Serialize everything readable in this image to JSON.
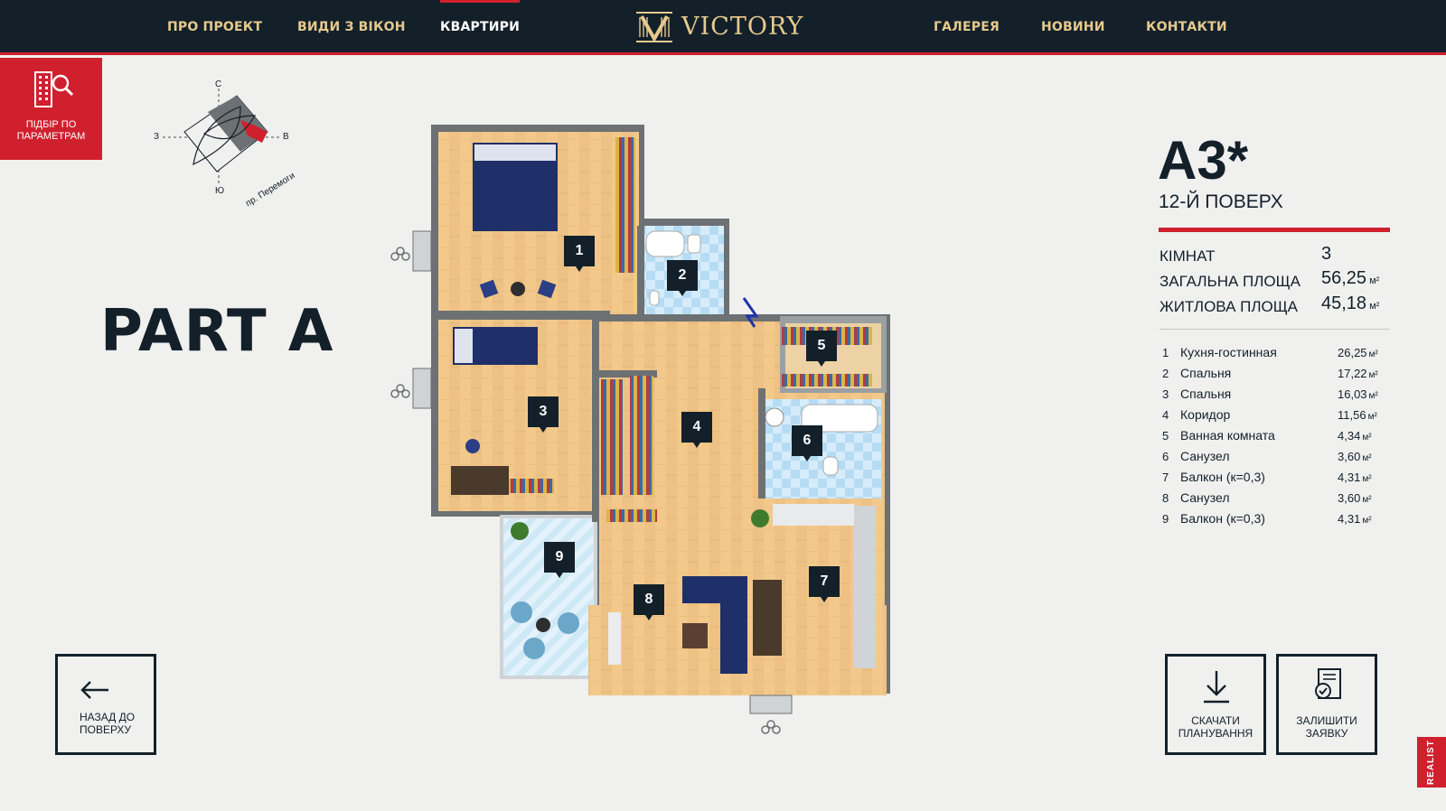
{
  "nav": {
    "left": [
      "ПРО ПРОЕКТ",
      "ВИДИ З ВІКОН",
      "КВАРТИРИ"
    ],
    "right": [
      "ГАЛЕРЕЯ",
      "НОВИНИ",
      "КОНТАКТИ"
    ],
    "active": "КВАРТИРИ",
    "logo_text": "VICTORY"
  },
  "filter": {
    "label": "ПІДБІР ПО ПАРАМЕТРАМ",
    "icon": "building-search-icon"
  },
  "compass": {
    "n": "С",
    "s": "Ю",
    "w": "З",
    "e": "В",
    "street": "пр. Перемоги"
  },
  "part_title": "PART A",
  "apartment": {
    "code": "А3*",
    "floor": "12-Й ПОВЕРХ",
    "stats": [
      {
        "label": "КІМНАТ",
        "value": "3",
        "unit": ""
      },
      {
        "label": "ЗАГАЛЬНА ПЛОЩА",
        "value": "56,25",
        "unit": "м²"
      },
      {
        "label": "ЖИТЛОВА ПЛОЩА",
        "value": "45,18",
        "unit": "м²"
      }
    ],
    "rooms": [
      {
        "num": "1",
        "name": "Кухня-гостинная",
        "area": "26,25",
        "unit": "м²"
      },
      {
        "num": "2",
        "name": "Спальня",
        "area": "17,22",
        "unit": "м²"
      },
      {
        "num": "3",
        "name": "Спальня",
        "area": "16,03",
        "unit": "м²"
      },
      {
        "num": "4",
        "name": "Коридор",
        "area": "11,56",
        "unit": "м²"
      },
      {
        "num": "5",
        "name": "Ванная комната",
        "area": "4,34",
        "unit": "м²"
      },
      {
        "num": "6",
        "name": "Санузел",
        "area": "3,60",
        "unit": "м²"
      },
      {
        "num": "7",
        "name": "Балкон (к=0,3)",
        "area": "4,31",
        "unit": "м²"
      },
      {
        "num": "8",
        "name": "Санузел",
        "area": "3,60",
        "unit": "м²"
      },
      {
        "num": "9",
        "name": "Балкон (к=0,3)",
        "area": "4,31",
        "unit": "м²"
      }
    ]
  },
  "plan_badges": [
    "1",
    "2",
    "3",
    "4",
    "5",
    "6",
    "7",
    "8",
    "9"
  ],
  "buttons": {
    "back": "НАЗАД ДО ПОВЕРХУ",
    "download": "СКАЧАТИ ПЛАНУВАННЯ",
    "request": "ЗАЛИШИТИ ЗАЯВКУ"
  },
  "realist_badge": "REALIST",
  "colors": {
    "dark": "#13202a",
    "accent": "#d0202e",
    "gold": "#e6c98d"
  }
}
